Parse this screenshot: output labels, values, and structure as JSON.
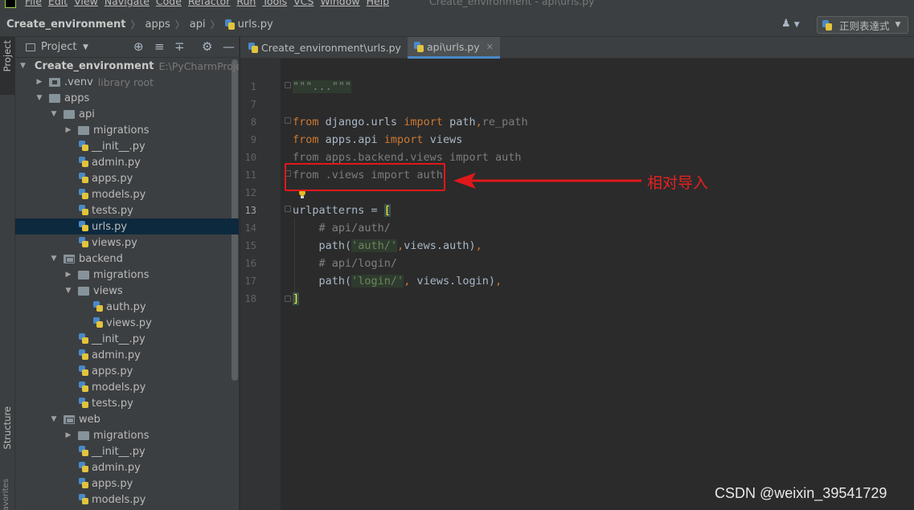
{
  "menu": {
    "items": [
      "File",
      "Edit",
      "View",
      "Navigate",
      "Code",
      "Refactor",
      "Run",
      "Tools",
      "VCS",
      "Window",
      "Help"
    ],
    "window_title": "Create_environment - api\\urls.py"
  },
  "breadcrumb": {
    "project": "Create_environment",
    "apps": "apps",
    "api": "api",
    "file": "urls.py"
  },
  "toolbar": {
    "user_icon": "person-icon",
    "regex_label": "正则表達式"
  },
  "side_strip": {
    "project": "Project",
    "structure": "Structure",
    "favorites": "Favorites"
  },
  "project_panel": {
    "title": "Project",
    "tree": [
      {
        "label": "Create_environment",
        "hint": "E:\\PyCharmProject"
      },
      {
        "label": ".venv",
        "hint": "library root"
      },
      {
        "label": "apps"
      },
      {
        "label": "api"
      },
      {
        "label": "migrations"
      },
      {
        "label": "__init__.py"
      },
      {
        "label": "admin.py"
      },
      {
        "label": "apps.py"
      },
      {
        "label": "models.py"
      },
      {
        "label": "tests.py"
      },
      {
        "label": "urls.py"
      },
      {
        "label": "views.py"
      },
      {
        "label": "backend"
      },
      {
        "label": "migrations"
      },
      {
        "label": "views"
      },
      {
        "label": "auth.py"
      },
      {
        "label": "views.py"
      },
      {
        "label": "__init__.py"
      },
      {
        "label": "admin.py"
      },
      {
        "label": "apps.py"
      },
      {
        "label": "models.py"
      },
      {
        "label": "tests.py"
      },
      {
        "label": "web"
      },
      {
        "label": "migrations"
      },
      {
        "label": "__init__.py"
      },
      {
        "label": "admin.py"
      },
      {
        "label": "apps.py"
      },
      {
        "label": "models.py"
      }
    ]
  },
  "tabs": [
    {
      "label": "Create_environment\\urls.py"
    },
    {
      "label": "api\\urls.py"
    }
  ],
  "editor": {
    "line_numbers": [
      "1",
      "7",
      "8",
      "9",
      "10",
      "11",
      "12",
      "13",
      "14",
      "15",
      "16",
      "17",
      "18"
    ],
    "l1": "\"\"\"...\"\"\"",
    "l8_kw1": "from",
    "l8_mod": " django.urls ",
    "l8_kw2": "import",
    "l8_name": " path",
    "l8_comma": ",",
    "l8_rest": "re_path",
    "l9_kw1": "from",
    "l9_mod": " apps.api ",
    "l9_kw2": "import",
    "l9_name": " views",
    "l10": "from apps.backend.views import auth",
    "l11": "from .views import auth",
    "l13_a": "urlpatterns = ",
    "l13_b": "[",
    "l14": "    # api/auth/",
    "l15_a": "    path(",
    "l15_s": "'auth/'",
    "l15_c": ",",
    "l15_b": "views.auth)",
    "l15_d": ",",
    "l16": "    # api/login/",
    "l17_a": "    path(",
    "l17_s": "'login/'",
    "l17_c": ", ",
    "l17_b": "views.login)",
    "l17_d": ",",
    "l18": "]"
  },
  "annotation": {
    "note": "相对导入"
  },
  "watermark": "CSDN @weixin_39541729"
}
